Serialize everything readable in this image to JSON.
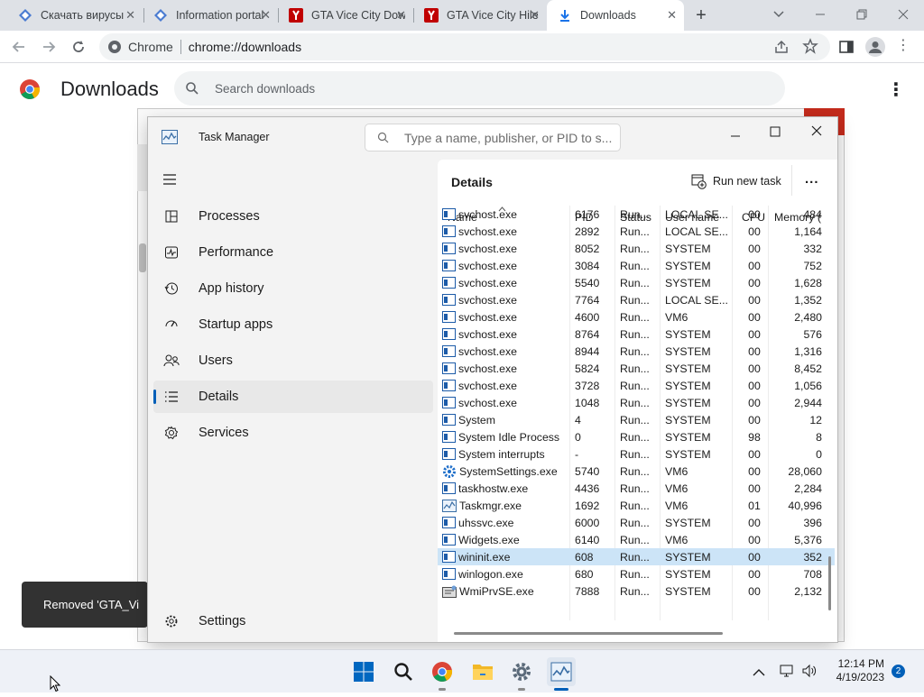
{
  "browser": {
    "tabs": [
      {
        "title": "Скачать вирусы",
        "icon": "puzzle-diamond-icon"
      },
      {
        "title": "Information portal",
        "icon": "puzzle-diamond-icon"
      },
      {
        "title": "GTA Vice City Download",
        "icon": "yandex-y-icon"
      },
      {
        "title": "GTA Vice City Hile",
        "icon": "yandex-y-icon"
      },
      {
        "title": "Downloads",
        "icon": "download-icon"
      }
    ],
    "omnibox": {
      "site_label": "Chrome",
      "url": "chrome://downloads"
    }
  },
  "downloads_page": {
    "title": "Downloads",
    "search_placeholder": "Search downloads",
    "toast_text": "Removed 'GTA_Vi"
  },
  "task_manager": {
    "title": "Task Manager",
    "search_placeholder": "Type a name, publisher, or PID to s...",
    "nav": [
      {
        "label": "Processes",
        "icon": "processes-icon"
      },
      {
        "label": "Performance",
        "icon": "performance-icon"
      },
      {
        "label": "App history",
        "icon": "app-history-icon"
      },
      {
        "label": "Startup apps",
        "icon": "startup-apps-icon"
      },
      {
        "label": "Users",
        "icon": "users-icon"
      },
      {
        "label": "Details",
        "icon": "details-icon",
        "selected": true
      },
      {
        "label": "Services",
        "icon": "services-icon"
      }
    ],
    "settings_label": "Settings",
    "section_title": "Details",
    "run_new_task_label": "Run new task",
    "more_label": "...",
    "columns": {
      "name": "Name",
      "pid": "PID",
      "status": "Status",
      "user": "User name",
      "cpu": "CPU",
      "memory": "Memory ("
    },
    "rows": [
      {
        "name": "svchost.exe",
        "pid": "6176",
        "status": "Run...",
        "user": "LOCAL SE...",
        "cpu": "00",
        "mem": "484",
        "icon": "svchost"
      },
      {
        "name": "svchost.exe",
        "pid": "2892",
        "status": "Run...",
        "user": "LOCAL SE...",
        "cpu": "00",
        "mem": "1,164",
        "icon": "svchost"
      },
      {
        "name": "svchost.exe",
        "pid": "8052",
        "status": "Run...",
        "user": "SYSTEM",
        "cpu": "00",
        "mem": "332",
        "icon": "svchost"
      },
      {
        "name": "svchost.exe",
        "pid": "3084",
        "status": "Run...",
        "user": "SYSTEM",
        "cpu": "00",
        "mem": "752",
        "icon": "svchost"
      },
      {
        "name": "svchost.exe",
        "pid": "5540",
        "status": "Run...",
        "user": "SYSTEM",
        "cpu": "00",
        "mem": "1,628",
        "icon": "svchost"
      },
      {
        "name": "svchost.exe",
        "pid": "7764",
        "status": "Run...",
        "user": "LOCAL SE...",
        "cpu": "00",
        "mem": "1,352",
        "icon": "svchost"
      },
      {
        "name": "svchost.exe",
        "pid": "4600",
        "status": "Run...",
        "user": "VM6",
        "cpu": "00",
        "mem": "2,480",
        "icon": "svchost"
      },
      {
        "name": "svchost.exe",
        "pid": "8764",
        "status": "Run...",
        "user": "SYSTEM",
        "cpu": "00",
        "mem": "576",
        "icon": "svchost"
      },
      {
        "name": "svchost.exe",
        "pid": "8944",
        "status": "Run...",
        "user": "SYSTEM",
        "cpu": "00",
        "mem": "1,316",
        "icon": "svchost"
      },
      {
        "name": "svchost.exe",
        "pid": "5824",
        "status": "Run...",
        "user": "SYSTEM",
        "cpu": "00",
        "mem": "8,452",
        "icon": "svchost"
      },
      {
        "name": "svchost.exe",
        "pid": "3728",
        "status": "Run...",
        "user": "SYSTEM",
        "cpu": "00",
        "mem": "1,056",
        "icon": "svchost"
      },
      {
        "name": "svchost.exe",
        "pid": "1048",
        "status": "Run...",
        "user": "SYSTEM",
        "cpu": "00",
        "mem": "2,944",
        "icon": "svchost"
      },
      {
        "name": "System",
        "pid": "4",
        "status": "Run...",
        "user": "SYSTEM",
        "cpu": "00",
        "mem": "12",
        "icon": "system"
      },
      {
        "name": "System Idle Process",
        "pid": "0",
        "status": "Run...",
        "user": "SYSTEM",
        "cpu": "98",
        "mem": "8",
        "icon": "system"
      },
      {
        "name": "System interrupts",
        "pid": "-",
        "status": "Run...",
        "user": "SYSTEM",
        "cpu": "00",
        "mem": "0",
        "icon": "system"
      },
      {
        "name": "SystemSettings.exe",
        "pid": "5740",
        "status": "Run...",
        "user": "VM6",
        "cpu": "00",
        "mem": "28,060",
        "icon": "gear"
      },
      {
        "name": "taskhostw.exe",
        "pid": "4436",
        "status": "Run...",
        "user": "VM6",
        "cpu": "00",
        "mem": "2,284",
        "icon": "svchost"
      },
      {
        "name": "Taskmgr.exe",
        "pid": "1692",
        "status": "Run...",
        "user": "VM6",
        "cpu": "01",
        "mem": "40,996",
        "icon": "taskmgr"
      },
      {
        "name": "uhssvc.exe",
        "pid": "6000",
        "status": "Run...",
        "user": "SYSTEM",
        "cpu": "00",
        "mem": "396",
        "icon": "svchost"
      },
      {
        "name": "Widgets.exe",
        "pid": "6140",
        "status": "Run...",
        "user": "VM6",
        "cpu": "00",
        "mem": "5,376",
        "icon": "svchost"
      },
      {
        "name": "wininit.exe",
        "pid": "608",
        "status": "Run...",
        "user": "SYSTEM",
        "cpu": "00",
        "mem": "352",
        "icon": "svchost",
        "selected": true
      },
      {
        "name": "winlogon.exe",
        "pid": "680",
        "status": "Run...",
        "user": "SYSTEM",
        "cpu": "00",
        "mem": "708",
        "icon": "svchost"
      },
      {
        "name": "WmiPrvSE.exe",
        "pid": "7888",
        "status": "Run...",
        "user": "SYSTEM",
        "cpu": "00",
        "mem": "2,132",
        "icon": "wmi"
      }
    ]
  },
  "taskbar": {
    "time": "12:14 PM",
    "date": "4/19/2023",
    "notification_count": "2",
    "apps": [
      "windows-start-icon",
      "search-icon",
      "chrome-icon",
      "file-explorer-icon",
      "settings-gear-icon",
      "task-manager-icon"
    ]
  },
  "colors": {
    "accent": "#005fb8",
    "chrome_tabstrip": "#dee1e6",
    "selected_row": "#cce4f7",
    "toast": "#323232"
  }
}
